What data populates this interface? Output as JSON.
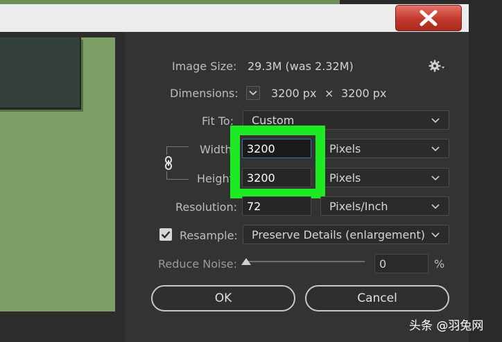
{
  "window": {
    "close_label": "X"
  },
  "image_size": {
    "label": "Image Size:",
    "value": "29.3M (was 2.32M)"
  },
  "dimensions": {
    "label": "Dimensions:",
    "width": "3200 px",
    "times": "×",
    "height": "3200 px"
  },
  "fit_to": {
    "label": "Fit To:",
    "value": "Custom"
  },
  "width": {
    "label": "Width",
    "value": "3200",
    "unit": "Pixels"
  },
  "height": {
    "label": "Height",
    "value": "3200",
    "unit": "Pixels"
  },
  "resolution": {
    "label": "Resolution:",
    "value": "72",
    "unit": "Pixels/Inch"
  },
  "resample": {
    "label": "Resample:",
    "checked": true,
    "value": "Preserve Details (enlargement)"
  },
  "reduce_noise": {
    "label": "Reduce Noise:",
    "value": "0",
    "unit": "%"
  },
  "buttons": {
    "ok": "OK",
    "cancel": "Cancel"
  },
  "watermark": {
    "text": "头条 @羽兔网"
  },
  "colors": {
    "highlight": "#1dea23",
    "close": "#c0392b",
    "preview": "#7e9e68"
  }
}
